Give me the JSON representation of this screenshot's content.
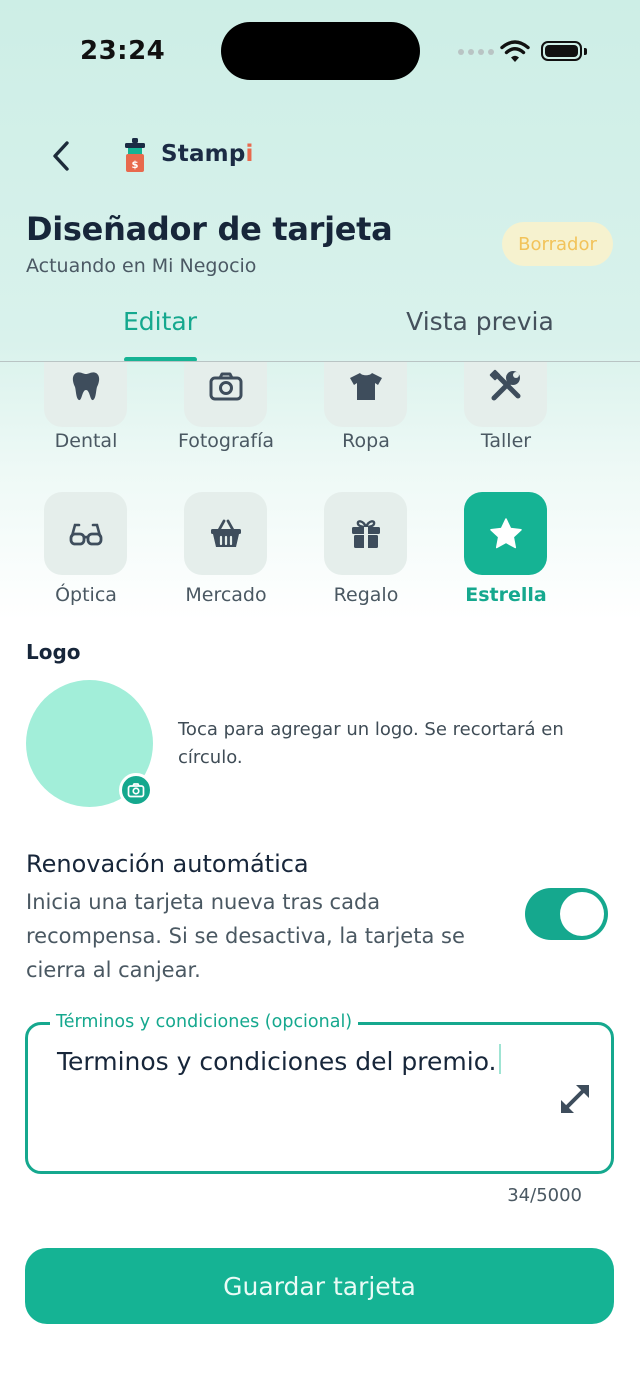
{
  "status_bar": {
    "time": "23:24",
    "icons": [
      "signal-icon",
      "wifi-icon",
      "battery-icon"
    ]
  },
  "header": {
    "back_icon": "chevron-left-icon",
    "brand": {
      "name_main": "Stamp",
      "name_accent": "i",
      "icon": "stampi-logo-icon"
    },
    "title": "Diseñador de tarjeta",
    "subtitle": "Actuando en Mi Negocio",
    "badge": "Borrador"
  },
  "tabs": [
    {
      "label": "Editar",
      "active": true
    },
    {
      "label": "Vista previa",
      "active": false
    }
  ],
  "categories": [
    {
      "label": "Dental",
      "icon": "tooth-icon",
      "selected": false
    },
    {
      "label": "Fotografía",
      "icon": "camera-icon",
      "selected": false
    },
    {
      "label": "Ropa",
      "icon": "shirt-icon",
      "selected": false
    },
    {
      "label": "Taller",
      "icon": "tools-icon",
      "selected": false
    },
    {
      "label": "Óptica",
      "icon": "glasses-icon",
      "selected": false
    },
    {
      "label": "Mercado",
      "icon": "basket-icon",
      "selected": false
    },
    {
      "label": "Regalo",
      "icon": "gift-icon",
      "selected": false
    },
    {
      "label": "Estrella",
      "icon": "star-icon",
      "selected": true
    }
  ],
  "logo": {
    "title": "Logo",
    "hint": "Toca para agregar un logo. Se recortará en círculo.",
    "camera_icon": "camera-icon"
  },
  "renewal": {
    "title": "Renovación automática",
    "description": "Inicia una tarjeta nueva tras cada recompensa. Si se desactiva, la tarjeta se cierra al canjear.",
    "enabled": true
  },
  "terms": {
    "label": "Términos y condiciones (opcional)",
    "value": "Terminos y condiciones del premio.",
    "counter": "34/5000",
    "expand_icon": "expand-icon"
  },
  "save_button": "Guardar tarjeta",
  "colors": {
    "accent": "#15B394",
    "accent_text": "#15A88E",
    "badge_bg": "#F6F2CF",
    "badge_text": "#F2C35A",
    "logo_placeholder": "#A2EED9",
    "brand_accent": "#E8694D"
  }
}
